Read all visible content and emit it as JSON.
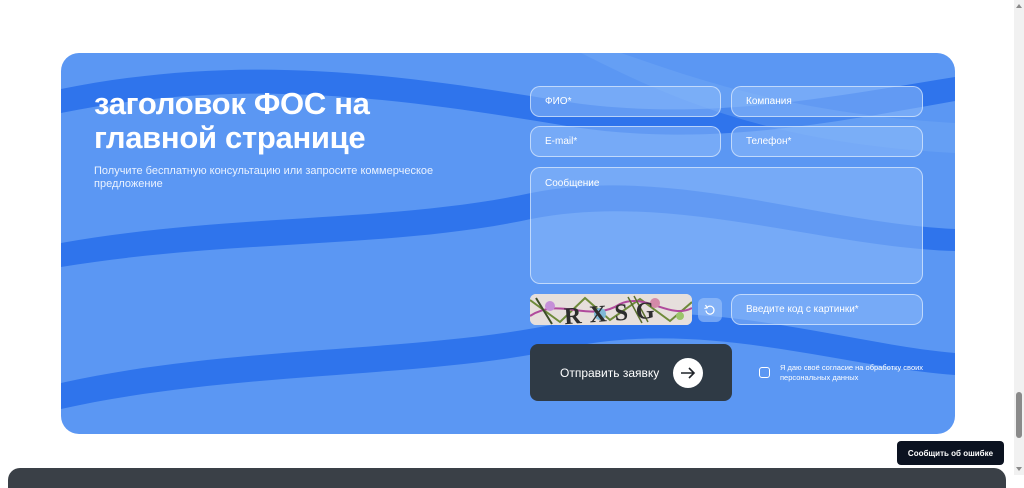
{
  "form": {
    "title": "заголовок ФОС на главной странице",
    "subtitle": "Получите бесплатную консультацию или запросите коммерческое предложение",
    "fields": {
      "fio": "ФИО*",
      "company": "Компания",
      "email": "E-mail*",
      "phone": "Телефон*",
      "message": "Сообщение",
      "captcha_code": "Введите код с картинки*"
    },
    "captcha_text": "RXSG",
    "submit_label": "Отправить заявку",
    "consent_text": "Я даю своё согласие на обработку своих персональных данных",
    "consent_checked": false
  },
  "report_button": "Сообщить об ошибке",
  "colors": {
    "card": "#5b97f3",
    "wave": "#2f74ec",
    "button": "#2f3a45"
  }
}
